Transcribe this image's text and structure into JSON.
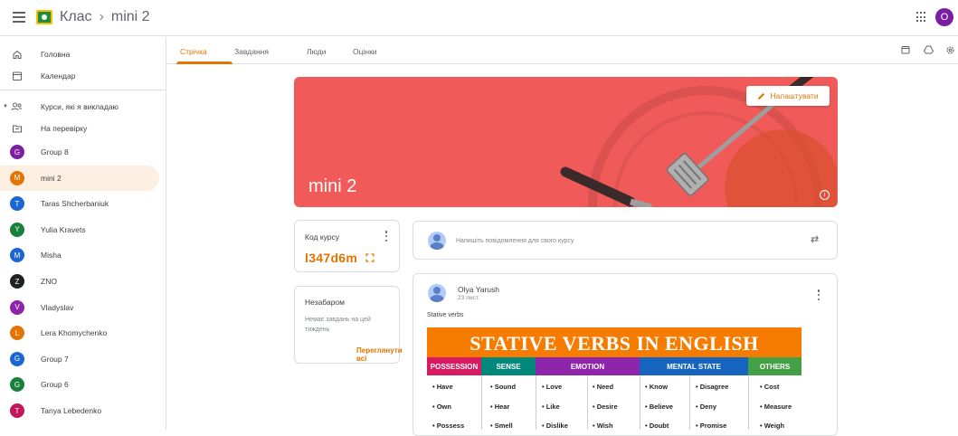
{
  "header": {
    "app_title": "Клас",
    "separator": "›",
    "class_name": "mini 2",
    "user_initial": "O"
  },
  "sidebar": {
    "items": [
      {
        "label": "Головна",
        "icon": "home-icon"
      },
      {
        "label": "Календар",
        "icon": "calendar-icon"
      },
      {
        "label": "Курси, які я викладаю",
        "icon": "teaching-icon"
      },
      {
        "label": "На перевірку",
        "icon": "review-folder-icon"
      }
    ],
    "classes": [
      {
        "label": "Group 8",
        "initial": "G",
        "color": "#7b1fa2"
      },
      {
        "label": "mini 2",
        "initial": "M",
        "color": "#e37400"
      },
      {
        "label": "Taras Shcherbaniuk",
        "initial": "T",
        "color": "#1967d2"
      },
      {
        "label": "Yulia Kravets",
        "initial": "Y",
        "color": "#188038"
      },
      {
        "label": "Misha",
        "initial": "M",
        "color": "#1967d2"
      },
      {
        "label": "ZNO",
        "initial": "Z",
        "color": "#202124"
      },
      {
        "label": "Vladyslav",
        "initial": "V",
        "color": "#8e24aa"
      },
      {
        "label": "Lera Khomychenko",
        "initial": "L",
        "color": "#e37400"
      },
      {
        "label": "Group 7",
        "initial": "G",
        "color": "#1967d2"
      },
      {
        "label": "Group 6",
        "initial": "G",
        "color": "#188038"
      },
      {
        "label": "Tanya Lebedenko",
        "initial": "T",
        "color": "#c2185b"
      }
    ]
  },
  "tabs": [
    "Стрічка",
    "Завдання",
    "Люди",
    "Оцінки"
  ],
  "banner": {
    "title": "mini 2",
    "customize_label": "Налаштувати",
    "color": "#f05a58"
  },
  "class_code": {
    "title": "Код курсу",
    "value": "l347d6m"
  },
  "upcoming": {
    "title": "Незабаром",
    "empty_text": "Немає завдань на цей тиждень",
    "view_all": "Переглянути всі"
  },
  "announce": {
    "placeholder": "Напишіть повідомлення для свого курсу"
  },
  "post": {
    "author": "Olya Yarush",
    "date": "23 лист.",
    "text": "Stative verbs"
  },
  "verbs_image": {
    "title": "STATIVE VERBS IN ENGLISH",
    "headers": [
      {
        "label": "POSSESSION",
        "color": "#d81b60"
      },
      {
        "label": "SENSE",
        "color": "#00897b"
      },
      {
        "label": "EMOTION",
        "color": "#8e24aa"
      },
      {
        "label": "MENTAL STATE",
        "color": "#1565c0"
      },
      {
        "label": "OTHERS",
        "color": "#43a047"
      }
    ],
    "rows": [
      [
        "• Have",
        "• Sound",
        "• Love",
        "• Need",
        "• Know",
        "• Disagree",
        "• Cost"
      ],
      [
        "• Own",
        "• Hear",
        "• Like",
        "• Desire",
        "• Believe",
        "• Deny",
        "• Measure"
      ],
      [
        "• Possess",
        "• Smell",
        "• Dislike",
        "• Wish",
        "• Doubt",
        "• Promise",
        "• Weigh"
      ]
    ]
  }
}
